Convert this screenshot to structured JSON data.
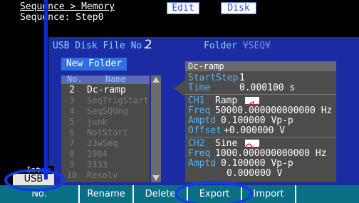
{
  "header": {
    "breadcrumb": "Sequence > Memory",
    "subtitle": "Sequence: Step0",
    "tab_edit": "Edit",
    "tab_disk": "Disk"
  },
  "panel": {
    "file_no_label": "USB Disk File No.",
    "file_no": "2",
    "folder_label": "Folder",
    "folder_path": "¥SEQ¥",
    "new_folder": "New Folder"
  },
  "list": {
    "col_no": "No.",
    "col_name": "Name",
    "rows": [
      {
        "no": "2",
        "name": "Dc-ramp"
      },
      {
        "no": "3",
        "name": "SeqTrigStart"
      },
      {
        "no": "4",
        "name": "SeqSQUng"
      },
      {
        "no": "5",
        "name": "junk"
      },
      {
        "no": "6",
        "name": "NotStart"
      },
      {
        "no": "7",
        "name": "33wSeq"
      },
      {
        "no": "8",
        "name": "1984"
      },
      {
        "no": "9",
        "name": "3333"
      },
      {
        "no": "10",
        "name": "Resolv"
      }
    ]
  },
  "detail": {
    "name": "Dc-ramp",
    "start_step_label": "StartStep",
    "start_step": "1",
    "time_label": "Time",
    "time": "0.000100 s",
    "ch1": {
      "label": "CH1",
      "wave": "Ramp",
      "wave_icon": "ramp-wave-icon",
      "freq_label": "Freq",
      "freq": "50000.000000000000 Hz",
      "amptd_label": "Amptd",
      "amptd": "0.100000 Vp-p",
      "offset_label": "Offset",
      "offset": "+0.000000 V"
    },
    "ch2": {
      "label": "CH2",
      "wave": "Sine",
      "wave_icon": "sine-wave-icon",
      "freq_label": "Freq",
      "freq": "1000.000000000000 Hz",
      "amptd_label": "Amptd",
      "amptd": "0.100000 Vp-p",
      "offset": "0.000000 V"
    }
  },
  "side": {
    "badge": "Int",
    "usb": "USB"
  },
  "softkeys": {
    "no": "No.",
    "rename": "Rename",
    "delete": "Delete",
    "export": "Export",
    "import": "Import"
  },
  "annotation_color": "#1438ee"
}
